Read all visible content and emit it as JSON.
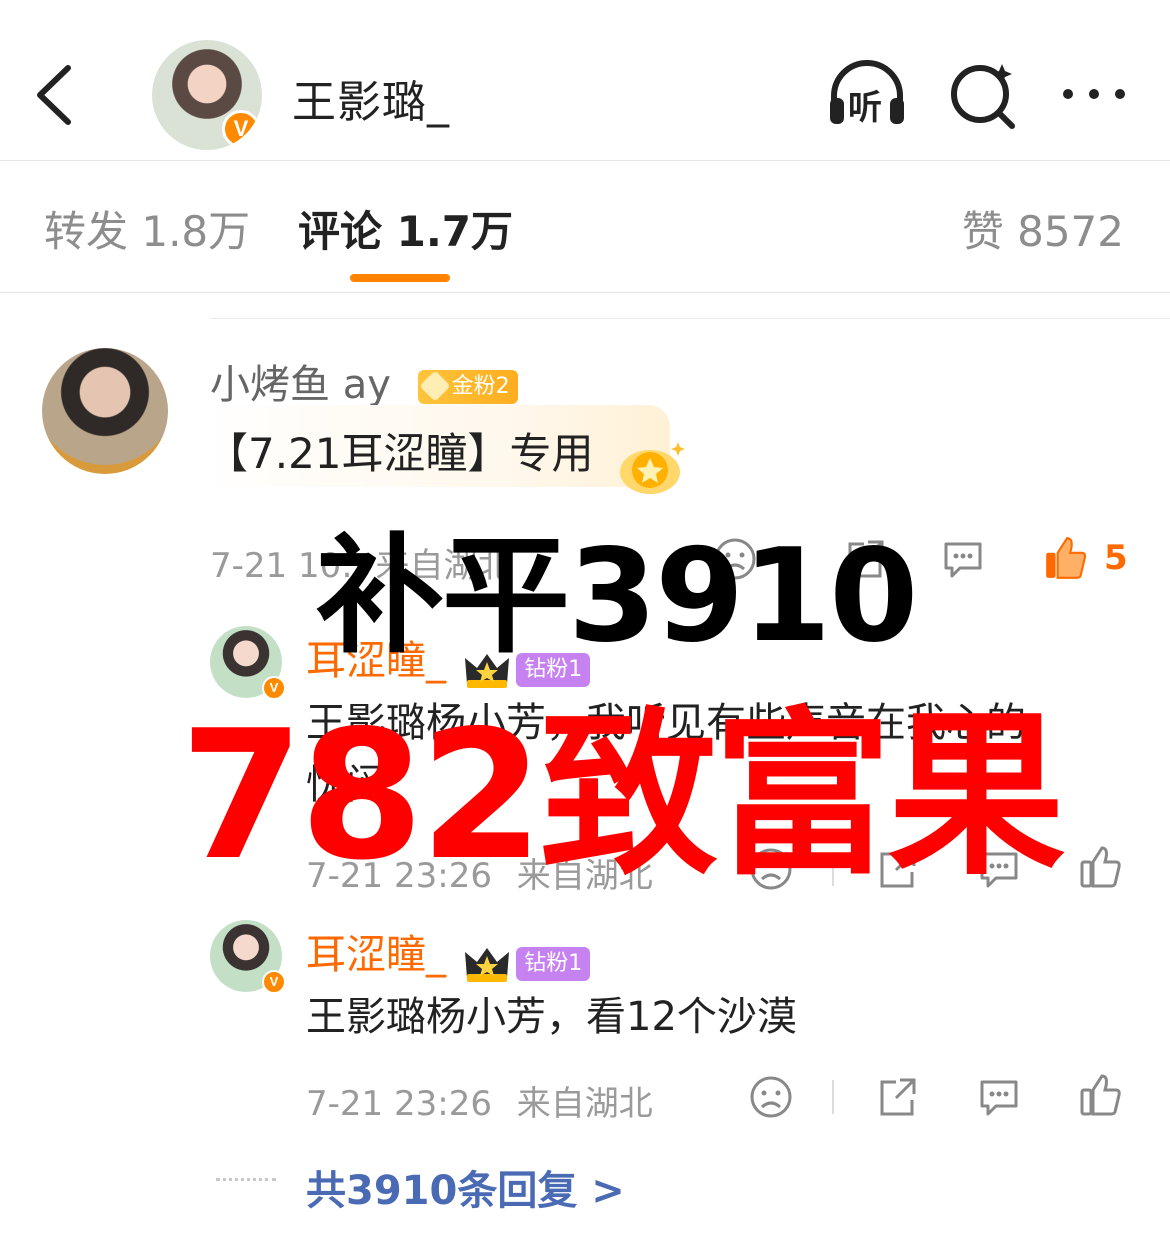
{
  "header": {
    "title": "王影璐_",
    "listen_label": "听"
  },
  "tabs": {
    "repost": "转发 1.8万",
    "comment": "评论 1.7万",
    "like": "赞 8572"
  },
  "comment": {
    "username": "小烤鱼 ay",
    "fan_badge": "金粉2",
    "text": "【7.21耳涩瞳】专用",
    "time": "7-21 10:",
    "location": "来自湖北",
    "like_count": "5"
  },
  "replies": [
    {
      "username": "耳涩瞳_",
      "fan_badge": "钻粉1",
      "text_line1": "王影璐杨小芳，我听见有些声音在我心的",
      "text_line2": "忧闷",
      "time": "7-21 23:26",
      "location": "来自湖北"
    },
    {
      "username": "耳涩瞳_",
      "fan_badge": "钻粉1",
      "text": "王影璐杨小芳，看12个沙漠",
      "time": "7-21 23:26",
      "location": "来自湖北"
    }
  ],
  "more_replies": "共3910条回复 >",
  "overlay": {
    "line1": "补平3910",
    "line2": "782致富果"
  },
  "colors": {
    "accent": "#ff8200",
    "username_orange": "#ff6a00",
    "link_blue": "#4a6bb3",
    "overlay_red": "#ff0000"
  }
}
